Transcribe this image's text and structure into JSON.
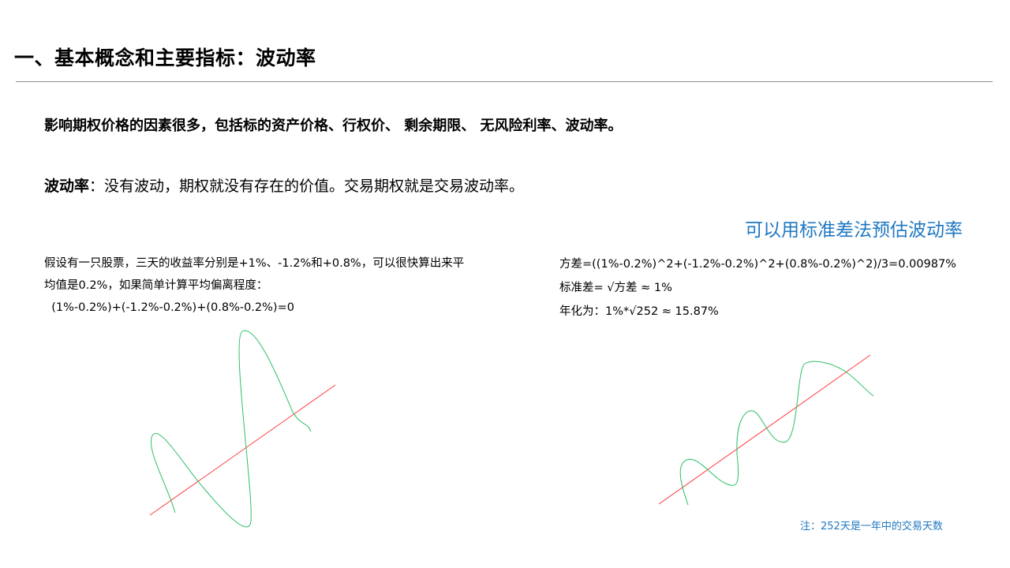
{
  "slide": {
    "title": "一、基本概念和主要指标：波动率",
    "intro": "影响期权价格的因素很多，包括标的资产价格、行权价、 剩余期限、 无风险利率、波动率。",
    "volatility_term": "波动率",
    "volatility_definition": "：没有波动，期权就没有存在的价值。交易期权就是交易波动率。",
    "method_heading": "可以用标准差法预估波动率",
    "example_lines": [
      "假设有一只股票，三天的收益率分别是+1%、-1.2%和+0.8%，可以很快算出来平",
      "均值是0.2%，如果简单计算平均偏离程度：",
      "  (1%-0.2%)+(-1.2%-0.2%)+(0.8%-0.2%)=0"
    ],
    "calc_lines": [
      "方差=((1%-0.2%)^2+(-1.2%-0.2%)^2+(0.8%-0.2%)^2)/3=0.00987%",
      "标准差= √方差 ≈ 1%",
      "年化为：1%*√252 ≈ 15.87%"
    ],
    "note": "注：252天是一年中的交易天数"
  },
  "colors": {
    "accent_blue": "#1f78c2",
    "trend_line": "#ff3b3b",
    "wave_line": "#2dbf6a",
    "rule": "#8c8c8c"
  }
}
